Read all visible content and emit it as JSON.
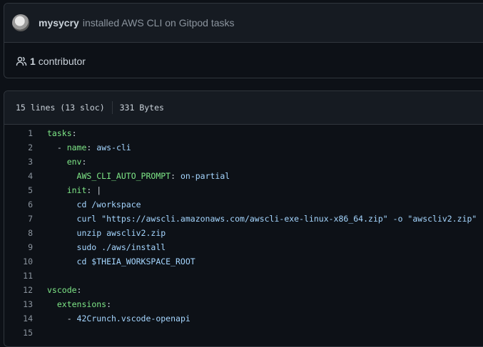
{
  "commit": {
    "author": "mysycry",
    "message": "installed AWS CLI on Gitpod tasks"
  },
  "contributors": {
    "count": "1",
    "label": "contributor"
  },
  "file": {
    "lines_info": "15 lines (13 sloc)",
    "size": "331 Bytes"
  },
  "code": {
    "lines": [
      {
        "n": "1",
        "segs": [
          {
            "t": "tasks",
            "c": "k"
          },
          {
            "t": ":",
            "c": "p"
          }
        ]
      },
      {
        "n": "2",
        "segs": [
          {
            "t": "  - ",
            "c": "p"
          },
          {
            "t": "name",
            "c": "k"
          },
          {
            "t": ": ",
            "c": "p"
          },
          {
            "t": "aws-cli",
            "c": "s"
          }
        ]
      },
      {
        "n": "3",
        "segs": [
          {
            "t": "    ",
            "c": "p"
          },
          {
            "t": "env",
            "c": "k"
          },
          {
            "t": ":",
            "c": "p"
          }
        ]
      },
      {
        "n": "4",
        "segs": [
          {
            "t": "      ",
            "c": "p"
          },
          {
            "t": "AWS_CLI_AUTO_PROMPT",
            "c": "k"
          },
          {
            "t": ": ",
            "c": "p"
          },
          {
            "t": "on-partial",
            "c": "s"
          }
        ]
      },
      {
        "n": "5",
        "segs": [
          {
            "t": "    ",
            "c": "p"
          },
          {
            "t": "init",
            "c": "k"
          },
          {
            "t": ": ",
            "c": "p"
          },
          {
            "t": "|",
            "c": "p"
          }
        ]
      },
      {
        "n": "6",
        "segs": [
          {
            "t": "      cd /workspace",
            "c": "s"
          }
        ]
      },
      {
        "n": "7",
        "segs": [
          {
            "t": "      curl \"https://awscli.amazonaws.com/awscli-exe-linux-x86_64.zip\" -o \"awscliv2.zip\"",
            "c": "s"
          }
        ]
      },
      {
        "n": "8",
        "segs": [
          {
            "t": "      unzip awscliv2.zip",
            "c": "s"
          }
        ]
      },
      {
        "n": "9",
        "segs": [
          {
            "t": "      sudo ./aws/install",
            "c": "s"
          }
        ]
      },
      {
        "n": "10",
        "segs": [
          {
            "t": "      cd $THEIA_WORKSPACE_ROOT",
            "c": "s"
          }
        ]
      },
      {
        "n": "11",
        "segs": []
      },
      {
        "n": "12",
        "segs": [
          {
            "t": "vscode",
            "c": "k"
          },
          {
            "t": ":",
            "c": "p"
          }
        ]
      },
      {
        "n": "13",
        "segs": [
          {
            "t": "  ",
            "c": "p"
          },
          {
            "t": "extensions",
            "c": "k"
          },
          {
            "t": ":",
            "c": "p"
          }
        ]
      },
      {
        "n": "14",
        "segs": [
          {
            "t": "    - ",
            "c": "p"
          },
          {
            "t": "42Crunch.vscode-openapi",
            "c": "s"
          }
        ]
      },
      {
        "n": "15",
        "segs": []
      }
    ]
  },
  "colors": {
    "background": "#0d1117",
    "header_bg": "#161b22",
    "border": "#30363d",
    "key": "#7ee787",
    "string": "#a5d6ff",
    "muted": "#8b949e"
  }
}
